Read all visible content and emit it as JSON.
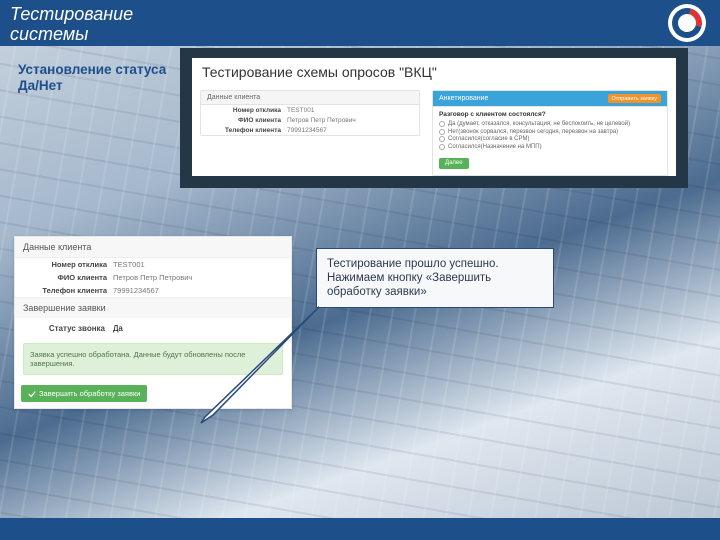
{
  "header": {
    "title": "Тестирование системы"
  },
  "subtitle": "Установление статуса Да/Нет",
  "app": {
    "title": "Тестирование схемы опросов \"ВКЦ\"",
    "client_panel": {
      "heading": "Данные клиента",
      "rows": [
        {
          "k": "Номер отклика",
          "v": "TEST001"
        },
        {
          "k": "ФИО клиента",
          "v": "Петров Петр Петрович"
        },
        {
          "k": "Телефон клиента",
          "v": "79991234567"
        }
      ]
    },
    "survey_panel": {
      "heading": "Анкетирование",
      "orange_btn": "Отправить заявку",
      "question": "Разговор с клиентом состоялся?",
      "options": [
        "Да (думает, отказался, консультация, не беспокоить, не целевой)",
        "Нет(звонок сорвался, перезвон сегодня, перезвон на завтра)",
        "Согласился(согласие в CPM)",
        "Согласился(Назначение на МПП)"
      ],
      "next_btn": "Далее"
    }
  },
  "result": {
    "heading1": "Данные клиента",
    "rows": [
      {
        "k": "Номер отклика",
        "v": "TEST001"
      },
      {
        "k": "ФИО клиента",
        "v": "Петров Петр Петрович"
      },
      {
        "k": "Телефон клиента",
        "v": "79991234567"
      }
    ],
    "heading2": "Завершение заявки",
    "status_label": "Статус звонка",
    "status_value": "Да",
    "alert": "Заявка успешно обработана. Данные будут обновлены после завершения.",
    "finish_btn": "Завершить обработку заявки"
  },
  "callout": "Тестирование прошло успешно. Нажимаем кнопку «Завершить обработку заявки»"
}
